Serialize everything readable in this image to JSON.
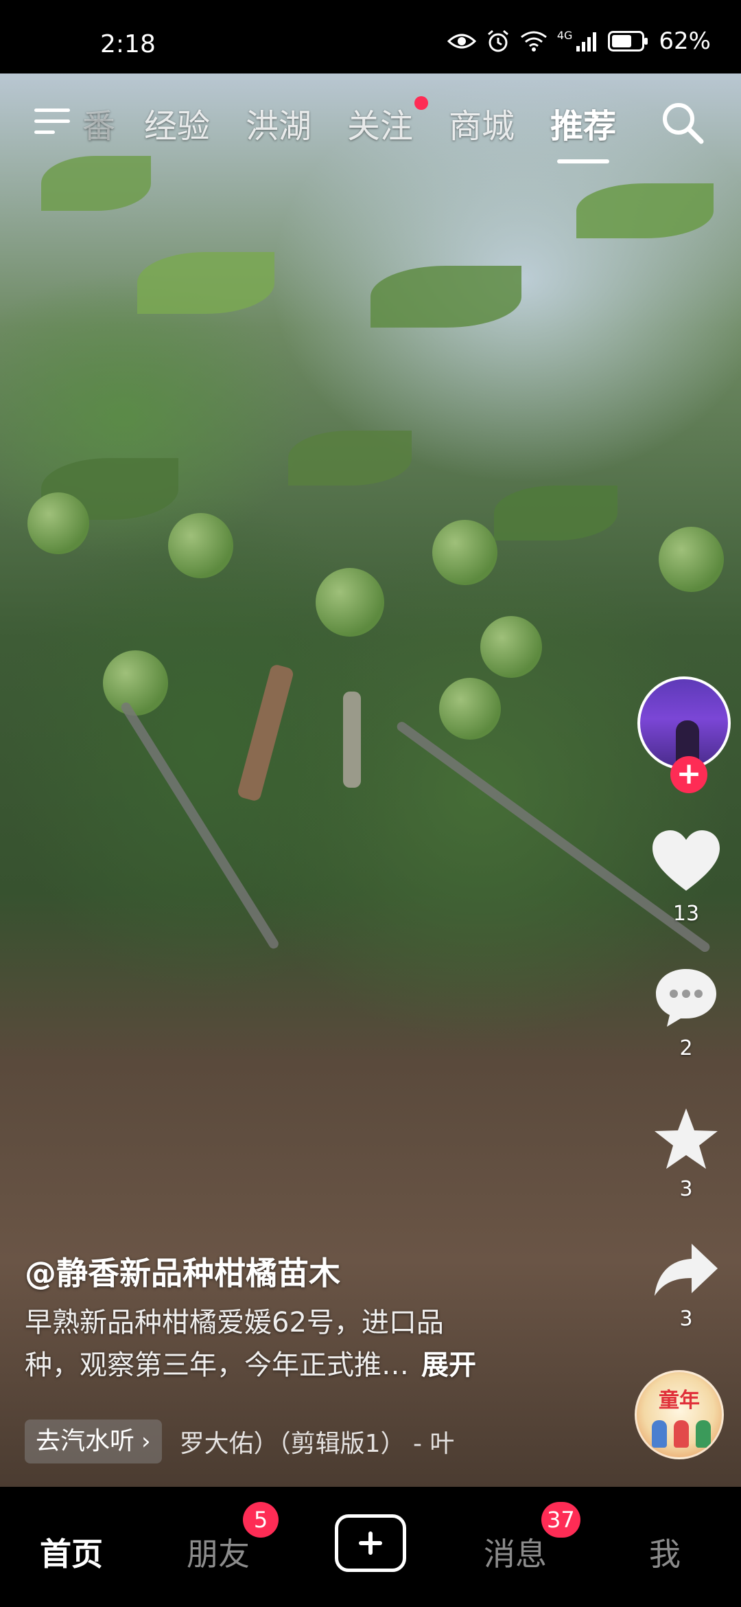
{
  "status_bar": {
    "time": "2:18",
    "network": "4G",
    "battery": "62%"
  },
  "top_nav": {
    "tabs": [
      {
        "label": "番",
        "state": "faded"
      },
      {
        "label": "经验",
        "state": "normal"
      },
      {
        "label": "洪湖",
        "state": "normal"
      },
      {
        "label": "关注",
        "state": "normal",
        "has_dot": true
      },
      {
        "label": "商城",
        "state": "normal"
      },
      {
        "label": "推荐",
        "state": "active"
      }
    ]
  },
  "actions": {
    "likes": "13",
    "comments": "2",
    "favorites": "3",
    "shares": "3"
  },
  "music_disc": {
    "label": "童年"
  },
  "caption": {
    "author": "@静香新品种柑橘苗木",
    "line1": "早熟新品种柑橘爱媛62号，进口品",
    "line2": "种，观察第三年，今年正式推…",
    "more": "展开"
  },
  "chip": {
    "label": "去汽水听",
    "chevron": "›",
    "music_text": "罗大佑）（剪辑版1） - 叶"
  },
  "bottom_nav": {
    "home": "首页",
    "friends": "朋友",
    "friends_badge": "5",
    "messages": "消息",
    "messages_badge": "37",
    "me": "我"
  },
  "colors": {
    "accent": "#fe2c55",
    "background": "#000000"
  }
}
